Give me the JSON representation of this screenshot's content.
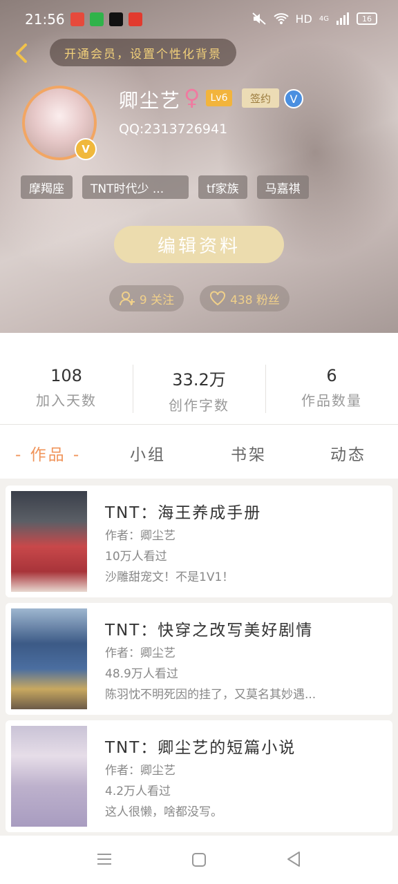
{
  "status_bar": {
    "time": "21:56",
    "network": "HD",
    "signal_label": "4G",
    "battery": "16"
  },
  "header": {
    "vip_banner": "开通会员，设置个性化背景",
    "username": "卿尘艺",
    "gender_symbol": "♀",
    "level": "Lv6",
    "signed_badge": "签约",
    "verify_mark": "V",
    "avatar_badge": "V",
    "qq": "QQ:2313726941",
    "tags": [
      "摩羯座",
      "TNT时代少 ...",
      "tf家族",
      "马嘉祺"
    ],
    "edit_button": "编辑资料",
    "following": "9 关注",
    "fans": "438 粉丝"
  },
  "stats": [
    {
      "value": "108",
      "label": "加入天数"
    },
    {
      "value": "33.2万",
      "label": "创作字数"
    },
    {
      "value": "6",
      "label": "作品数量"
    }
  ],
  "tabs": [
    {
      "label": "- 作品 -",
      "active": true
    },
    {
      "label": "小组",
      "active": false
    },
    {
      "label": "书架",
      "active": false
    },
    {
      "label": "动态",
      "active": false
    }
  ],
  "works": [
    {
      "title": "TNT：海王养成手册",
      "author": "作者：卿尘艺",
      "views": "10万人看过",
      "desc": "沙雕甜宠文！不是1V1！"
    },
    {
      "title": "TNT：快穿之改写美好剧情",
      "author": "作者：卿尘艺",
      "views": "48.9万人看过",
      "desc": "陈羽忱不明死因的挂了，又莫名其妙遇..."
    },
    {
      "title": "TNT：卿尘艺的短篇小说",
      "author": "作者：卿尘艺",
      "views": "4.2万人看过",
      "desc": "这人很懒，啥都没写。"
    }
  ],
  "colors": {
    "accent": "#f0945a",
    "vip_gold": "#f1d07a",
    "level_badge": "#f2b43c",
    "edit_button": "#ecdcae"
  }
}
